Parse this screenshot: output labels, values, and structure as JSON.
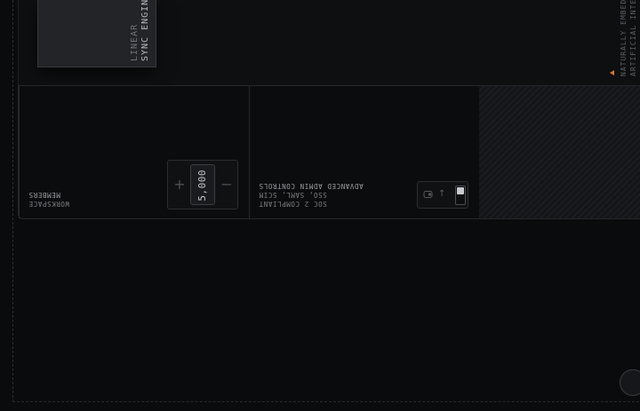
{
  "hero_card": {
    "title": "SYNC ENGINE",
    "subtitle": "LINEAR"
  },
  "side_caption": {
    "line1": "NATURALLY EMBED",
    "line2": "ARTIFICIAL INTE"
  },
  "members_panel": {
    "label_line1": "WORKSPACE",
    "label_line2": "MEMBERS",
    "stepper": {
      "value": "5,000",
      "plus_label": "+",
      "minus_label": "−"
    }
  },
  "security_panel": {
    "label_line1": "SOC 2 COMPLIANT",
    "label_line2": "SSO, SAML, SCIM",
    "label_line3": "ADVANCED ADMIN CONTROLS",
    "toggle": {
      "arrow": "→",
      "state": "on"
    }
  },
  "accent_color": "#d8772e"
}
